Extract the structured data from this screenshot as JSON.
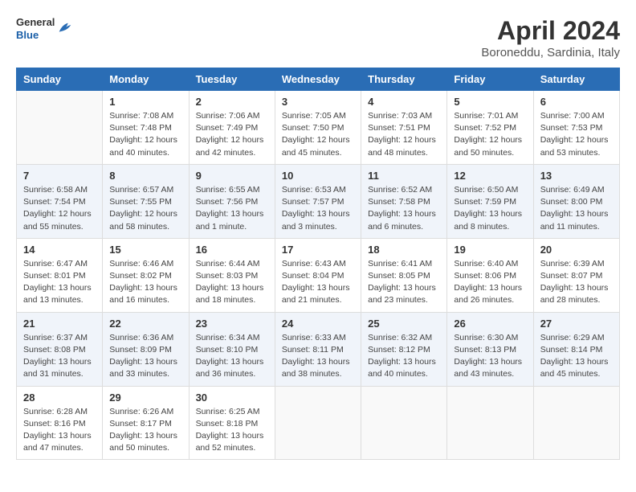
{
  "header": {
    "logo": {
      "general": "General",
      "blue": "Blue"
    },
    "title": "April 2024",
    "subtitle": "Boroneddu, Sardinia, Italy"
  },
  "days_of_week": [
    "Sunday",
    "Monday",
    "Tuesday",
    "Wednesday",
    "Thursday",
    "Friday",
    "Saturday"
  ],
  "weeks": [
    [
      {
        "day": "",
        "info": ""
      },
      {
        "day": "1",
        "info": "Sunrise: 7:08 AM\nSunset: 7:48 PM\nDaylight: 12 hours\nand 40 minutes."
      },
      {
        "day": "2",
        "info": "Sunrise: 7:06 AM\nSunset: 7:49 PM\nDaylight: 12 hours\nand 42 minutes."
      },
      {
        "day": "3",
        "info": "Sunrise: 7:05 AM\nSunset: 7:50 PM\nDaylight: 12 hours\nand 45 minutes."
      },
      {
        "day": "4",
        "info": "Sunrise: 7:03 AM\nSunset: 7:51 PM\nDaylight: 12 hours\nand 48 minutes."
      },
      {
        "day": "5",
        "info": "Sunrise: 7:01 AM\nSunset: 7:52 PM\nDaylight: 12 hours\nand 50 minutes."
      },
      {
        "day": "6",
        "info": "Sunrise: 7:00 AM\nSunset: 7:53 PM\nDaylight: 12 hours\nand 53 minutes."
      }
    ],
    [
      {
        "day": "7",
        "info": "Sunrise: 6:58 AM\nSunset: 7:54 PM\nDaylight: 12 hours\nand 55 minutes."
      },
      {
        "day": "8",
        "info": "Sunrise: 6:57 AM\nSunset: 7:55 PM\nDaylight: 12 hours\nand 58 minutes."
      },
      {
        "day": "9",
        "info": "Sunrise: 6:55 AM\nSunset: 7:56 PM\nDaylight: 13 hours\nand 1 minute."
      },
      {
        "day": "10",
        "info": "Sunrise: 6:53 AM\nSunset: 7:57 PM\nDaylight: 13 hours\nand 3 minutes."
      },
      {
        "day": "11",
        "info": "Sunrise: 6:52 AM\nSunset: 7:58 PM\nDaylight: 13 hours\nand 6 minutes."
      },
      {
        "day": "12",
        "info": "Sunrise: 6:50 AM\nSunset: 7:59 PM\nDaylight: 13 hours\nand 8 minutes."
      },
      {
        "day": "13",
        "info": "Sunrise: 6:49 AM\nSunset: 8:00 PM\nDaylight: 13 hours\nand 11 minutes."
      }
    ],
    [
      {
        "day": "14",
        "info": "Sunrise: 6:47 AM\nSunset: 8:01 PM\nDaylight: 13 hours\nand 13 minutes."
      },
      {
        "day": "15",
        "info": "Sunrise: 6:46 AM\nSunset: 8:02 PM\nDaylight: 13 hours\nand 16 minutes."
      },
      {
        "day": "16",
        "info": "Sunrise: 6:44 AM\nSunset: 8:03 PM\nDaylight: 13 hours\nand 18 minutes."
      },
      {
        "day": "17",
        "info": "Sunrise: 6:43 AM\nSunset: 8:04 PM\nDaylight: 13 hours\nand 21 minutes."
      },
      {
        "day": "18",
        "info": "Sunrise: 6:41 AM\nSunset: 8:05 PM\nDaylight: 13 hours\nand 23 minutes."
      },
      {
        "day": "19",
        "info": "Sunrise: 6:40 AM\nSunset: 8:06 PM\nDaylight: 13 hours\nand 26 minutes."
      },
      {
        "day": "20",
        "info": "Sunrise: 6:39 AM\nSunset: 8:07 PM\nDaylight: 13 hours\nand 28 minutes."
      }
    ],
    [
      {
        "day": "21",
        "info": "Sunrise: 6:37 AM\nSunset: 8:08 PM\nDaylight: 13 hours\nand 31 minutes."
      },
      {
        "day": "22",
        "info": "Sunrise: 6:36 AM\nSunset: 8:09 PM\nDaylight: 13 hours\nand 33 minutes."
      },
      {
        "day": "23",
        "info": "Sunrise: 6:34 AM\nSunset: 8:10 PM\nDaylight: 13 hours\nand 36 minutes."
      },
      {
        "day": "24",
        "info": "Sunrise: 6:33 AM\nSunset: 8:11 PM\nDaylight: 13 hours\nand 38 minutes."
      },
      {
        "day": "25",
        "info": "Sunrise: 6:32 AM\nSunset: 8:12 PM\nDaylight: 13 hours\nand 40 minutes."
      },
      {
        "day": "26",
        "info": "Sunrise: 6:30 AM\nSunset: 8:13 PM\nDaylight: 13 hours\nand 43 minutes."
      },
      {
        "day": "27",
        "info": "Sunrise: 6:29 AM\nSunset: 8:14 PM\nDaylight: 13 hours\nand 45 minutes."
      }
    ],
    [
      {
        "day": "28",
        "info": "Sunrise: 6:28 AM\nSunset: 8:16 PM\nDaylight: 13 hours\nand 47 minutes."
      },
      {
        "day": "29",
        "info": "Sunrise: 6:26 AM\nSunset: 8:17 PM\nDaylight: 13 hours\nand 50 minutes."
      },
      {
        "day": "30",
        "info": "Sunrise: 6:25 AM\nSunset: 8:18 PM\nDaylight: 13 hours\nand 52 minutes."
      },
      {
        "day": "",
        "info": ""
      },
      {
        "day": "",
        "info": ""
      },
      {
        "day": "",
        "info": ""
      },
      {
        "day": "",
        "info": ""
      }
    ]
  ]
}
